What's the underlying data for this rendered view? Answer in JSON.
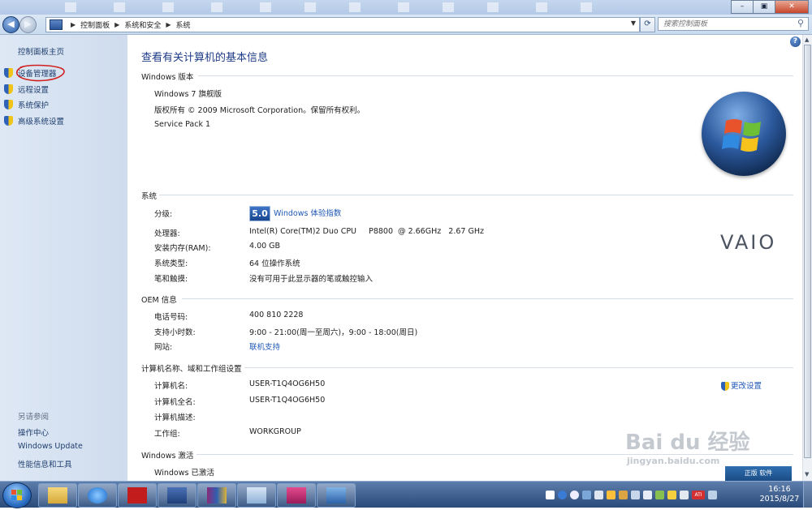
{
  "window": {
    "breadcrumb": [
      "控制面板",
      "系统和安全",
      "系统"
    ],
    "search_placeholder": "搜索控制面板"
  },
  "sidebar": {
    "home": "控制面板主页",
    "tasks": [
      "设备管理器",
      "远程设置",
      "系统保护",
      "高级系统设置"
    ],
    "see_also_title": "另请参阅",
    "see_also": [
      "操作中心",
      "Windows Update",
      "性能信息和工具"
    ]
  },
  "main": {
    "title": "查看有关计算机的基本信息",
    "edition": {
      "heading": "Windows 版本",
      "name": "Windows 7 旗舰版",
      "copyright": "版权所有 © 2009 Microsoft Corporation。保留所有权利。",
      "service_pack": "Service Pack 1"
    },
    "system": {
      "heading": "系统",
      "rating_label": "分级:",
      "rating_value": "5.0",
      "rating_link": "Windows 体验指数",
      "processor_label": "处理器:",
      "processor_value": "Intel(R) Core(TM)2 Duo CPU     P8800  @ 2.66GHz   2.67 GHz",
      "ram_label": "安装内存(RAM):",
      "ram_value": "4.00 GB",
      "type_label": "系统类型:",
      "type_value": "64 位操作系统",
      "pen_label": "笔和触摸:",
      "pen_value": "没有可用于此显示器的笔或触控输入"
    },
    "oem": {
      "heading": "OEM 信息",
      "phone_label": "电话号码:",
      "phone_value": "400 810 2228",
      "hours_label": "支持小时数:",
      "hours_value": "9:00 - 21:00(周一至周六)，9:00 - 18:00(周日)",
      "website_label": "网站:",
      "website_value": "联机支持",
      "brand": "VAIO"
    },
    "computer": {
      "heading": "计算机名称、域和工作组设置",
      "name_label": "计算机名:",
      "name_value": "USER-T1Q4OG6H50",
      "fullname_label": "计算机全名:",
      "fullname_value": "USER-T1Q4OG6H50",
      "desc_label": "计算机描述:",
      "workgroup_label": "工作组:",
      "workgroup_value": "WORKGROUP",
      "change_link": "更改设置"
    },
    "activation": {
      "heading": "Windows 激活",
      "status": "Windows 已激活"
    }
  },
  "watermark": {
    "brand": "Bai du 经验",
    "url": "jingyan.baidu.com"
  },
  "promo": {
    "text": "正版 软件"
  },
  "taskbar": {
    "time": "16:16",
    "date": "2015/8/27",
    "ati": "ATI"
  },
  "colors": {
    "link": "#1f58b6",
    "title": "#1e3b87",
    "sidebar_bg": "#dee8f5",
    "taskbar": "#294a7a",
    "annotation": "#d01f1f"
  }
}
